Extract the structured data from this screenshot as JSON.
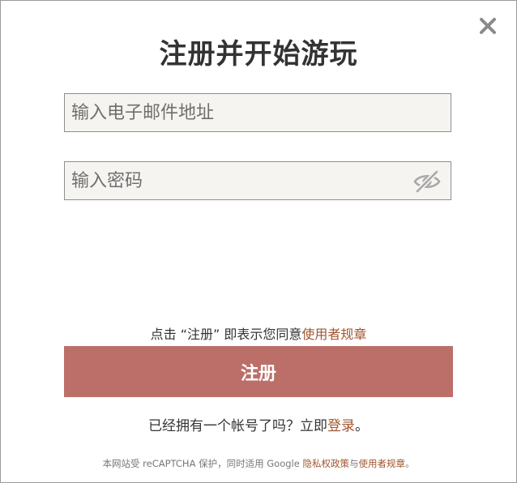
{
  "dialog": {
    "title": "注册并开始游玩",
    "close_icon": "close-icon"
  },
  "form": {
    "email_placeholder": "输入电子邮件地址",
    "email_value": "",
    "password_placeholder": "输入密码",
    "password_value": "",
    "password_toggle_icon": "eye-slash-icon"
  },
  "terms": {
    "prefix": "点击 “注册” 即表示您同意",
    "link_label": "使用者规章"
  },
  "register_button": {
    "label": "注册",
    "color": "#bc6f69"
  },
  "login_prompt": {
    "text": "已经拥有一个帐号了吗？立即",
    "link_label": "登录",
    "suffix": "。"
  },
  "recaptcha": {
    "prefix": "本网站受 reCAPTCHA 保护，同时适用 Google ",
    "privacy_link": "隐私权政策",
    "and_text": "与",
    "terms_link": "使用者规章",
    "suffix": "。"
  },
  "colors": {
    "link": "#a2552f",
    "field_bg": "#f6f4f1"
  }
}
